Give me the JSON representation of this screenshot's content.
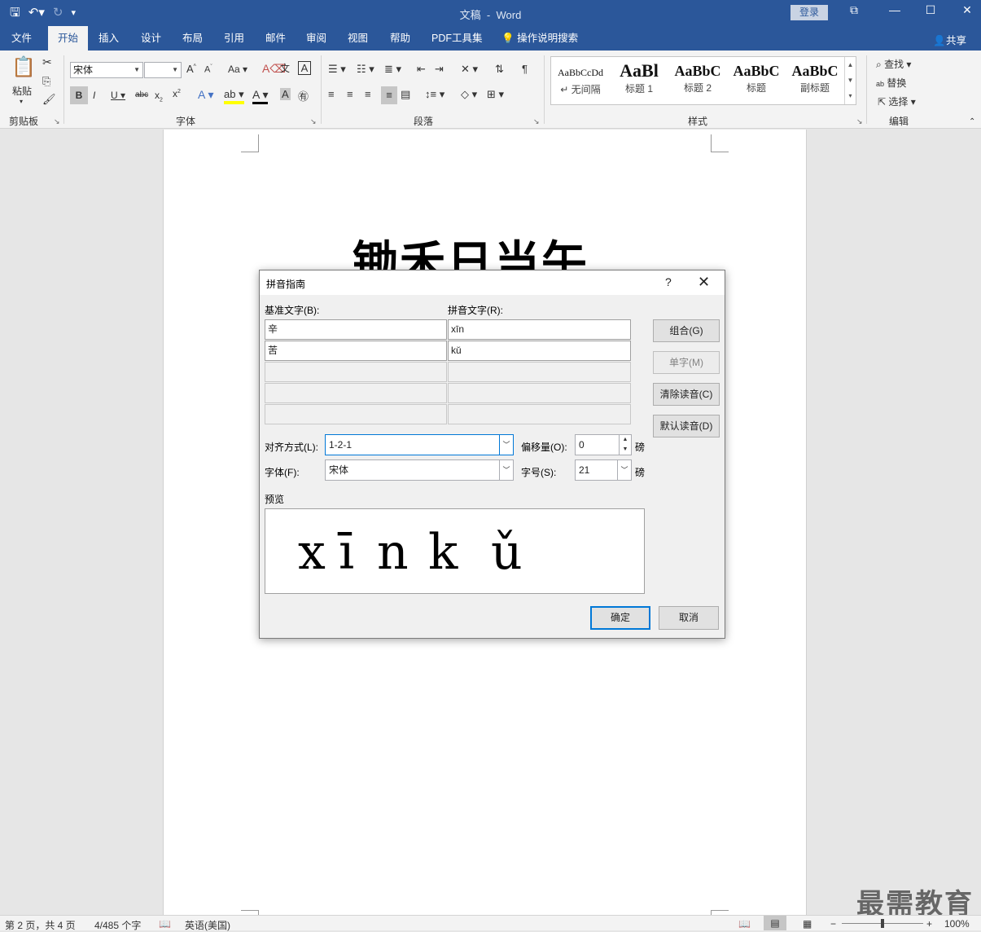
{
  "titlebar": {
    "doc_name": "文稿",
    "separator": "-",
    "app_name": "Word",
    "login": "登录"
  },
  "tabs": [
    "文件",
    "开始",
    "插入",
    "设计",
    "布局",
    "引用",
    "邮件",
    "审阅",
    "视图",
    "帮助",
    "PDF工具集"
  ],
  "tell_me": "操作说明搜索",
  "share": "共享",
  "ribbon": {
    "paste": "粘贴",
    "clipboard": "剪贴板",
    "font_name": "宋体",
    "font_group": "字体",
    "paragraph_group": "段落",
    "styles_group": "样式",
    "editing_group": "编辑",
    "aa_case": "Aa",
    "find": "查找",
    "replace": "替换",
    "select": "选择"
  },
  "styles": [
    {
      "preview": "AaBbCcDd",
      "name": "↵ 无间隔"
    },
    {
      "preview": "AaBl",
      "name": "标题 1"
    },
    {
      "preview": "AaBbC",
      "name": "标题 2"
    },
    {
      "preview": "AaBbC",
      "name": "标题"
    },
    {
      "preview": "AaBbC",
      "name": "副标题"
    }
  ],
  "document": {
    "heading": "锄禾日当午"
  },
  "dialog": {
    "title": "拼音指南",
    "help": "?",
    "base_text_label": "基准文字(B):",
    "ruby_text_label": "拼音文字(R):",
    "rows": [
      {
        "base": "辛",
        "ruby": "xīn"
      },
      {
        "base": "苦",
        "ruby": "kǔ"
      }
    ],
    "buttons": {
      "group": "组合(G)",
      "mono": "单字(M)",
      "clear": "清除读音(C)",
      "default": "默认读音(D)",
      "ok": "确定",
      "cancel": "取消"
    },
    "alignment_label": "对齐方式(L):",
    "alignment_value": "1-2-1",
    "offset_label": "偏移量(O):",
    "offset_value": "0",
    "offset_unit": "磅",
    "font_label": "字体(F):",
    "font_value": "宋体",
    "size_label": "字号(S):",
    "size_value": "21",
    "size_unit": "磅",
    "preview_label": "预览",
    "preview_text": [
      "x",
      "ī",
      "n",
      "k",
      "ǔ"
    ]
  },
  "status": {
    "page": "第 2 页，共 4 页",
    "words": "4/485 个字",
    "language": "英语(美国)",
    "zoom": "100%"
  },
  "watermark": "最需教育",
  "colors": {
    "brand": "#2b579a",
    "focus": "#0078d7"
  }
}
